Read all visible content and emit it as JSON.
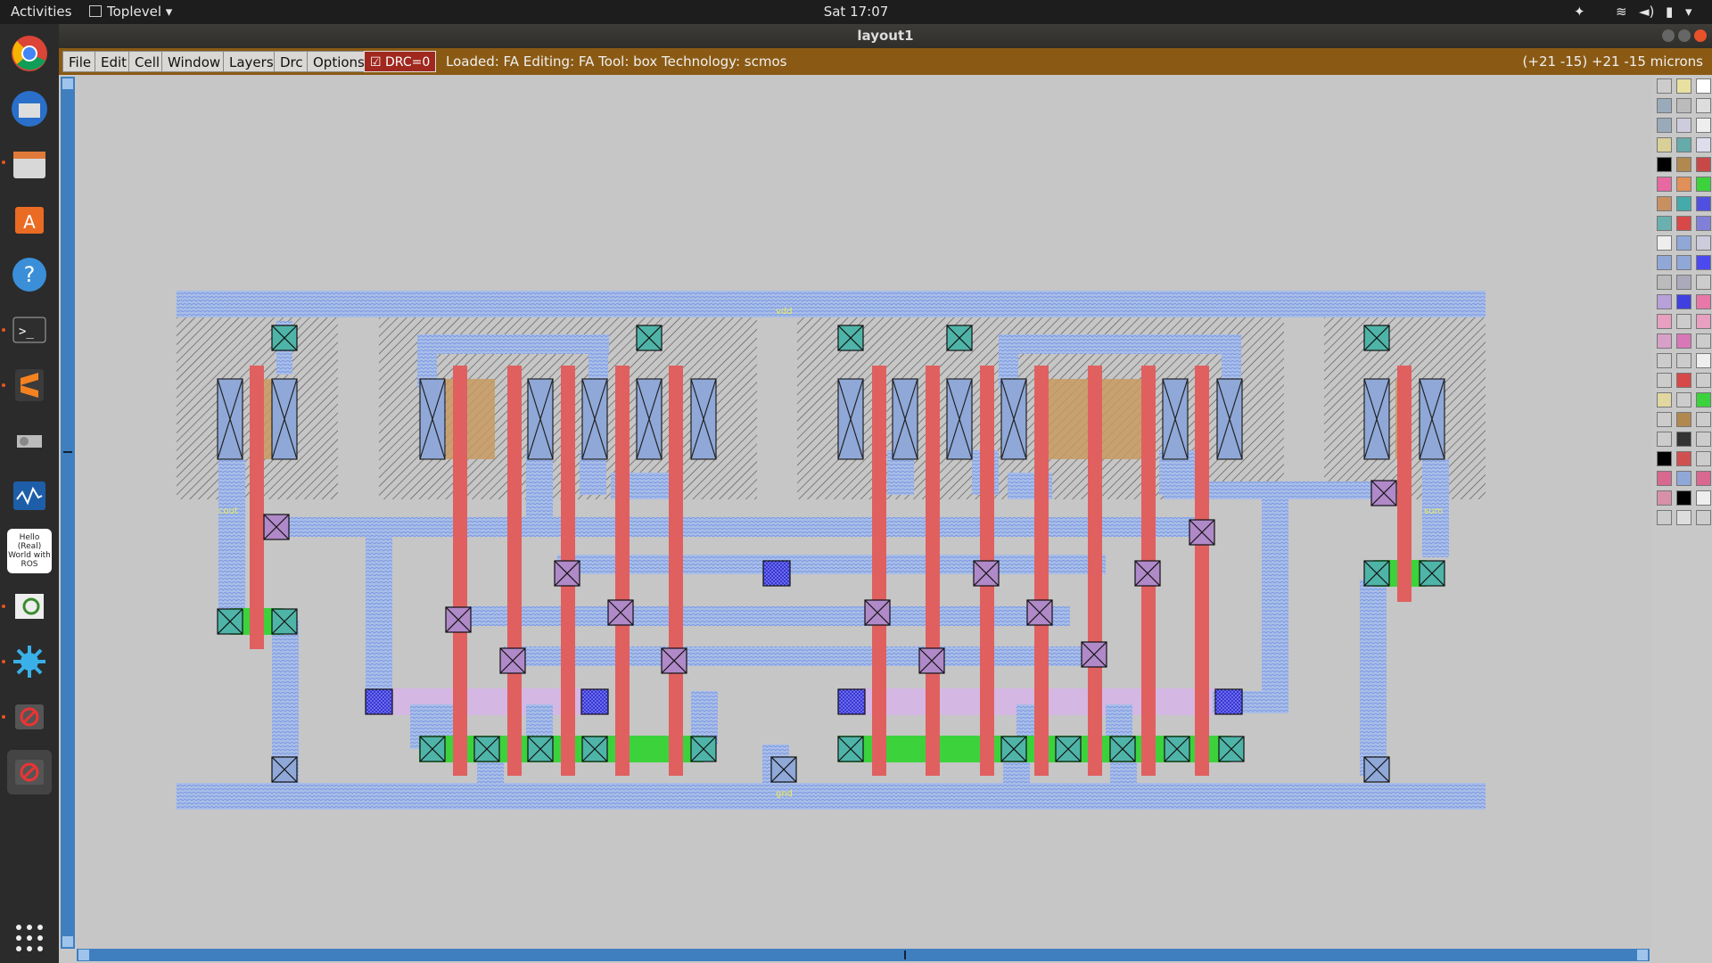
{
  "topbar": {
    "activities": "Activities",
    "app": "Toplevel",
    "clock": "Sat 17:07"
  },
  "window": {
    "title": "layout1"
  },
  "menus": [
    "File",
    "Edit",
    "Cell",
    "Window",
    "Layers",
    "Drc",
    "Options"
  ],
  "drc": {
    "label": "DRC=0",
    "checked": true
  },
  "status": "Loaded: FA Editing: FA Tool: box  Technology: scmos",
  "coords": "(+21 -15) +21 -15 microns",
  "dock": {
    "hello_label": "Hello (Real) World with ROS"
  },
  "icons": [
    "chrome-icon",
    "thunderbird-icon",
    "files-icon",
    "software-center-icon",
    "help-icon",
    "terminal-icon",
    "sublime-icon",
    "system-tools-icon",
    "system-monitor-icon",
    "ros-book-icon",
    "image-viewer-icon",
    "settings-icon",
    "blocked-app-icon",
    "blocked-app-icon",
    "app-grid-icon"
  ],
  "layout_labels": {
    "vdd": "vdd",
    "gnd": "gnd",
    "cout": "cout",
    "sum": "sum"
  },
  "colors": {
    "metal1": "#8fa8e6",
    "poly": "#e05a5a",
    "ndiff": "#3cd23c",
    "nwell": "#555555",
    "pselect": "#c9a070",
    "contact": "#4aa0a0",
    "via": "#5050e0",
    "metal2": "#d0b0e8"
  }
}
